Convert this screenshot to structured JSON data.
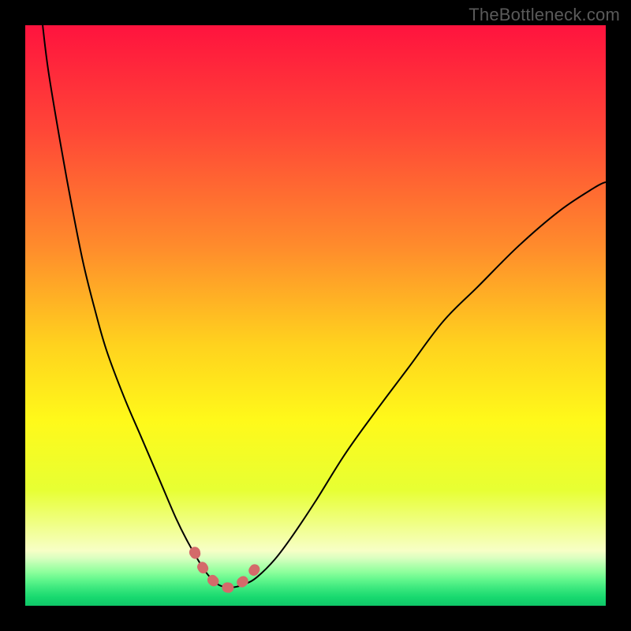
{
  "watermark": "TheBottleneck.com",
  "chart_data": {
    "type": "line",
    "title": "",
    "xlabel": "",
    "ylabel": "",
    "xlim": [
      0,
      100
    ],
    "ylim": [
      0,
      100
    ],
    "series": [
      {
        "name": "bottleneck-curve",
        "x": [
          3,
          4,
          6,
          8,
          10,
          12,
          14,
          17,
          20,
          23,
          26,
          28,
          30,
          31.5,
          33,
          34.5,
          36,
          38,
          40,
          43,
          46,
          50,
          55,
          60,
          66,
          72,
          78,
          85,
          92,
          98,
          100
        ],
        "y": [
          100,
          92,
          80,
          69,
          59,
          51,
          44,
          36,
          29,
          22,
          15,
          11,
          7.5,
          5.3,
          3.8,
          3.2,
          3.2,
          3.8,
          5,
          8,
          12,
          18,
          26,
          33,
          41,
          49,
          55,
          62,
          68,
          72,
          73
        ]
      },
      {
        "name": "highlight-segment",
        "x": [
          29.2,
          30,
          31.5,
          33,
          34.5,
          36,
          37.5,
          39,
          40.3
        ],
        "y": [
          9.2,
          7.5,
          5.3,
          3.8,
          3.2,
          3.2,
          4.2,
          5.6,
          7.4
        ]
      }
    ],
    "highlight_dot": {
      "x": 29.2,
      "y": 9.2
    },
    "gradient_stops": [
      {
        "offset": 0.0,
        "color": "#ff133e"
      },
      {
        "offset": 0.18,
        "color": "#ff4637"
      },
      {
        "offset": 0.38,
        "color": "#ff8b2c"
      },
      {
        "offset": 0.55,
        "color": "#ffd21e"
      },
      {
        "offset": 0.68,
        "color": "#fff91a"
      },
      {
        "offset": 0.8,
        "color": "#e7ff33"
      },
      {
        "offset": 0.905,
        "color": "#f7ffc6"
      },
      {
        "offset": 0.918,
        "color": "#d9ffc0"
      },
      {
        "offset": 0.93,
        "color": "#b2ffad"
      },
      {
        "offset": 0.942,
        "color": "#8dff9c"
      },
      {
        "offset": 0.955,
        "color": "#63f78d"
      },
      {
        "offset": 0.968,
        "color": "#3fe97f"
      },
      {
        "offset": 0.985,
        "color": "#18d96f"
      },
      {
        "offset": 1.0,
        "color": "#0fc768"
      }
    ],
    "colors": {
      "curve": "#000000",
      "highlight": "#d46a6a",
      "frame": "#000000"
    }
  }
}
